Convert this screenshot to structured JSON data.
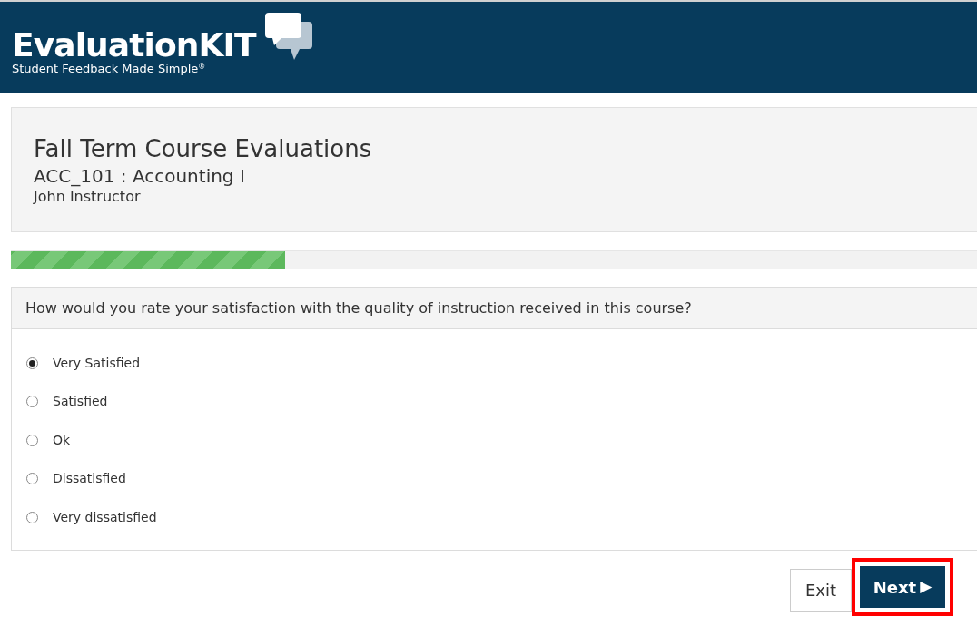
{
  "header": {
    "logo": "EvaluationKIT",
    "tagline": "Student Feedback Made Simple",
    "tagline_mark": "®"
  },
  "course": {
    "title": "Fall Term Course Evaluations",
    "course": "ACC_101 : Accounting I",
    "instructor": "John Instructor"
  },
  "progress": {
    "level": 0.284
  },
  "question": {
    "text": "How would you rate your satisfaction with the quality of instruction received in this course?",
    "options": [
      {
        "label": "Very Satisfied",
        "selected": true
      },
      {
        "label": "Satisfied",
        "selected": false
      },
      {
        "label": "Ok",
        "selected": false
      },
      {
        "label": "Dissatisfied",
        "selected": false
      },
      {
        "label": "Very dissatisfied",
        "selected": false
      }
    ]
  },
  "buttons": {
    "exit": "Exit",
    "next": "Next",
    "next_arrow": "▶",
    "next_highlighted": true
  }
}
